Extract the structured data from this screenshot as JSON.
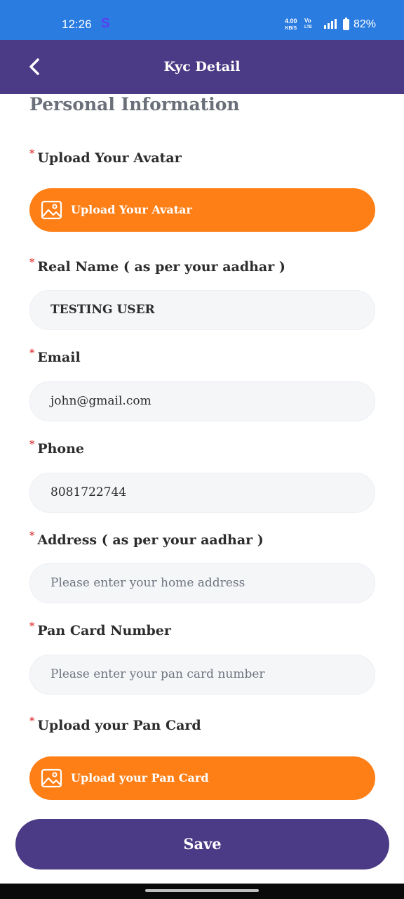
{
  "status_bar": {
    "time": "12:26",
    "app_indicator": "S",
    "net_speed_value": "4.00",
    "net_speed_unit": "KB/S",
    "volte_top": "Vo",
    "volte_bottom": "LTE",
    "battery_percent": "82%"
  },
  "header": {
    "title": "Kyc Detail",
    "back_icon": "chevron-left-icon"
  },
  "form": {
    "section_title": "Personal Information",
    "required_mark": "*",
    "avatar": {
      "label": "Upload Your Avatar",
      "button_label": "Upload Your Avatar",
      "icon": "image-icon"
    },
    "real_name": {
      "label": "Real Name ( as per your aadhar )",
      "value": "TESTING USER"
    },
    "email": {
      "label": "Email",
      "value": "john@gmail.com"
    },
    "phone": {
      "label": "Phone",
      "value": "8081722744"
    },
    "address": {
      "label": "Address ( as per your aadhar )",
      "placeholder": "Please enter your home address"
    },
    "pan_number": {
      "label": "Pan Card Number",
      "placeholder": "Please enter your pan card number"
    },
    "pan_card": {
      "label": "Upload your Pan Card",
      "button_label": "Upload your Pan Card",
      "icon": "image-icon"
    },
    "save_label": "Save"
  },
  "colors": {
    "status_bar": "#2a7ce0",
    "app_bar": "#4b3a85",
    "upload_button": "#ff7f17",
    "save_button": "#4b3a85",
    "required_star": "#e03030"
  }
}
